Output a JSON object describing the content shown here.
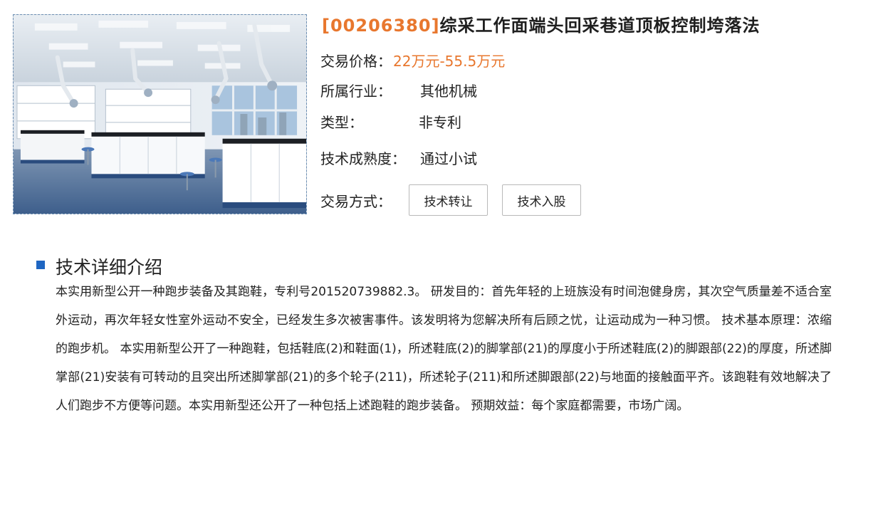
{
  "product": {
    "image_icon": "laboratory-photo",
    "code": "[00206380]",
    "title": "综采工作面端头回采巷道顶板控制垮落法"
  },
  "info": {
    "price_label": "交易价格：",
    "price_value": "22万元-55.5万元",
    "industry_label": "所属行业：",
    "industry_value": "其他机械",
    "type_label": "类型：",
    "type_value": "非专利",
    "maturity_label": "技术成熟度：",
    "maturity_value": "通过小试",
    "trade_label": "交易方式：",
    "trade_options": [
      "技术转让",
      "技术入股"
    ]
  },
  "detail": {
    "section_title": "技术详细介绍",
    "text": "本实用新型公开一种跑步装备及其跑鞋，专利号201520739882.3。        研发目的：首先年轻的上班族没有时间泡健身房，其次空气质量差不适合室外运动，再次年轻女性室外运动不安全，已经发生多次被害事件。该发明将为您解决所有后顾之忧，让运动成为一种习惯。        技术基本原理：浓缩的跑步机。        本实用新型公开了一种跑鞋，包括鞋底(2)和鞋面(1)，所述鞋底(2)的脚掌部(21)的厚度小于所述鞋底(2)的脚跟部(22)的厚度，所述脚掌部(21)安装有可转动的且突出所述脚掌部(21)的多个轮子(211)，所述轮子(211)和所述脚跟部(22)与地面的接触面平齐。该跑鞋有效地解决了人们跑步不方便等问题。本实用新型还公开了一种包括上述跑鞋的跑步装备。        预期效益：每个家庭都需要，市场广阔。"
  },
  "colors": {
    "accent": "#e8772e",
    "section_marker": "#1f66c2"
  }
}
